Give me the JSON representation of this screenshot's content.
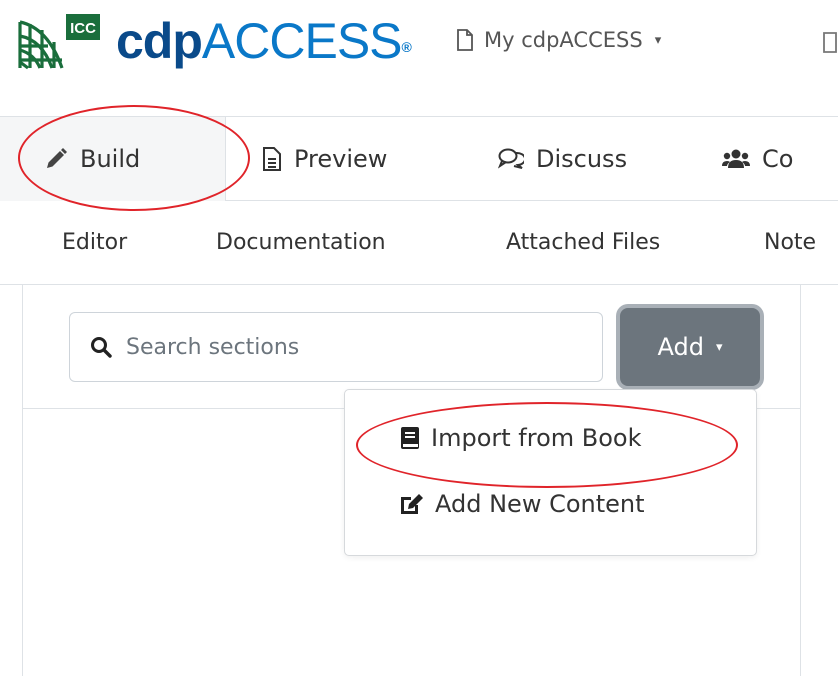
{
  "header": {
    "logo_text_cdp": "cdp",
    "logo_text_access": "ACCESS",
    "logo_registered": "®",
    "logo_badge": "ICC",
    "nav_my_cdpaccess": "My cdpACCESS",
    "nav_caret": "▾"
  },
  "tabs": [
    {
      "label": "Build",
      "icon": "pencil-icon",
      "active": true
    },
    {
      "label": "Preview",
      "icon": "document-icon",
      "active": false
    },
    {
      "label": "Discuss",
      "icon": "comments-icon",
      "active": false
    },
    {
      "label": "Co",
      "icon": "users-icon",
      "active": false
    }
  ],
  "subnav": [
    "Editor",
    "Documentation",
    "Attached Files",
    "Note"
  ],
  "search": {
    "placeholder": "Search sections",
    "value": ""
  },
  "add_button": {
    "label": "Add",
    "caret": "▾"
  },
  "dropdown": {
    "items": [
      {
        "label": "Import from Book",
        "icon": "book-icon"
      },
      {
        "label": "Add New Content",
        "icon": "edit-icon"
      }
    ]
  },
  "colors": {
    "logo_dark": "#0a4a8a",
    "logo_light": "#0a78c8",
    "add_button_bg": "#6c757d",
    "annotation_red": "#e0242a"
  }
}
